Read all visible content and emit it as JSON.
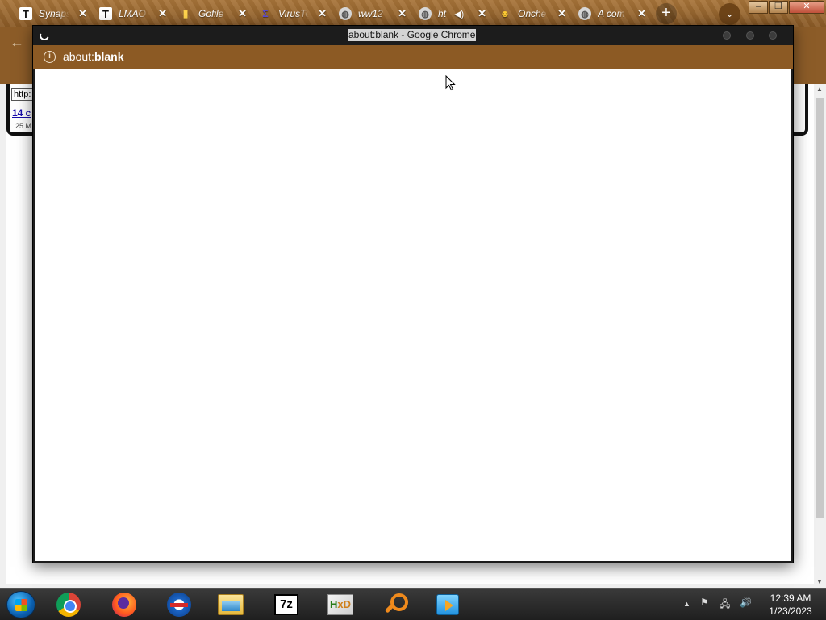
{
  "tabs": [
    {
      "title": "Synapse",
      "icon": "t-logo-icon"
    },
    {
      "title": "LMAO",
      "icon": "t-logo-icon"
    },
    {
      "title": "Gofile",
      "icon": "gofile-icon"
    },
    {
      "title": "VirusTotal",
      "icon": "virustotal-icon"
    },
    {
      "title": "ww12",
      "icon": "globe-icon"
    },
    {
      "title": "ht",
      "icon": "globe-icon",
      "audio": true
    },
    {
      "title": "Onche",
      "icon": "onche-icon"
    },
    {
      "title": "A com",
      "icon": "globe-icon"
    }
  ],
  "background_page": {
    "url_field_value": "http:",
    "link_text": "14 c",
    "date_text": "25 M"
  },
  "popup": {
    "title": "about:blank - Google Chrome",
    "url_prefix": "about:",
    "url_bold": "blank"
  },
  "taskbar": {
    "apps": [
      "start-button",
      "chrome",
      "firefox",
      "internet-explorer",
      "file-explorer",
      "7-zip",
      "hxd",
      "search",
      "media-player"
    ],
    "clock_time": "12:39 AM",
    "clock_date": "1/23/2023"
  },
  "colors": {
    "popup_addressbar": "#8c5a24",
    "taskbar": "#2a2a2a"
  }
}
